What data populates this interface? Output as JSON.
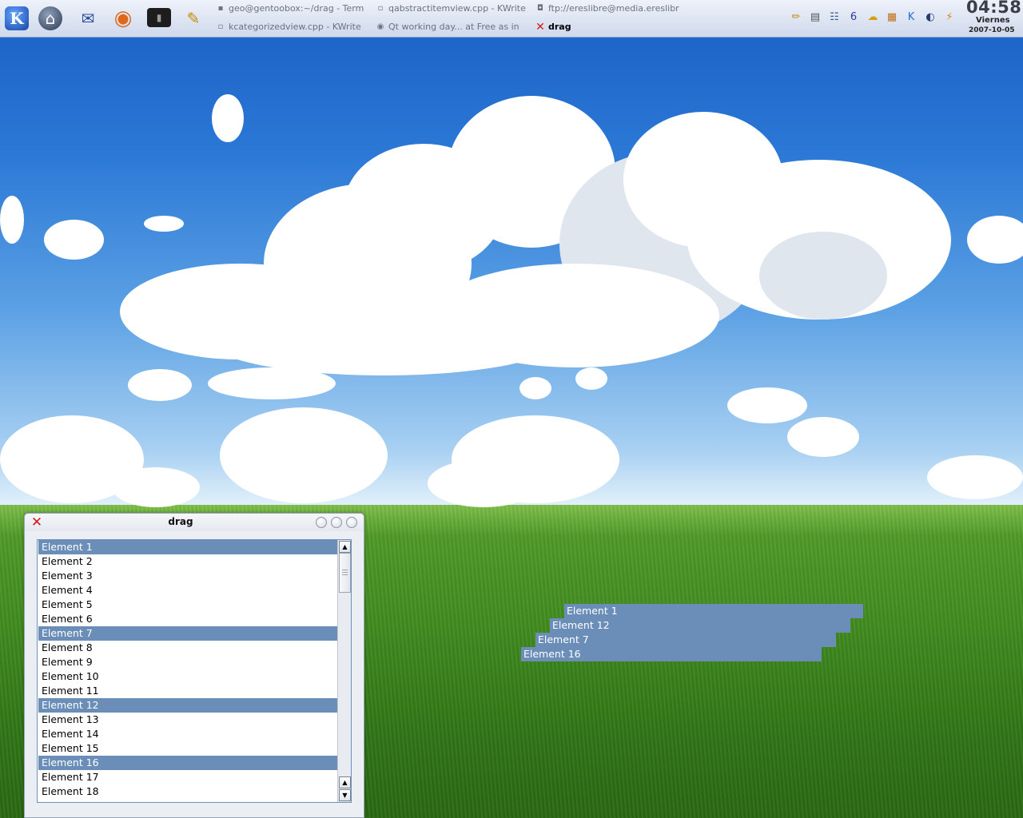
{
  "taskbar": {
    "launchers": [
      {
        "name": "kde-menu",
        "icon": "kde-logo-icon",
        "glyph": "K"
      },
      {
        "name": "home",
        "icon": "home-icon",
        "glyph": "⌂"
      },
      {
        "name": "calendar-mail",
        "icon": "calendar-mail-icon",
        "glyph": "✉"
      },
      {
        "name": "firefox",
        "icon": "firefox-icon",
        "glyph": "◉"
      },
      {
        "name": "terminal",
        "icon": "terminal-icon",
        "glyph": "▮"
      },
      {
        "name": "text-editor",
        "icon": "text-editor-icon",
        "glyph": "✎"
      }
    ],
    "tasks": [
      {
        "label": "geo@gentoobox:~/drag - Term",
        "icon": "terminal-icon",
        "glyph": "▪",
        "active": false
      },
      {
        "label": "qabstractitemview.cpp - KWrite",
        "icon": "kwrite-icon",
        "glyph": "▫",
        "active": false
      },
      {
        "label": "ftp://ereslibre@media.ereslibr",
        "icon": "ftp-icon",
        "glyph": "◘",
        "active": false
      },
      {
        "label": "kcategorizedview.cpp - KWrite",
        "icon": "kwrite-icon",
        "glyph": "▫",
        "active": false
      },
      {
        "label": "Qt working day... at Free as in",
        "icon": "firefox-icon",
        "glyph": "◉",
        "active": false
      },
      {
        "label": "drag",
        "icon": "x11-icon",
        "glyph": "✕",
        "active": true
      }
    ],
    "tray": [
      {
        "icon": "pencil-icon",
        "glyph": "✏"
      },
      {
        "icon": "clipboard-icon",
        "glyph": "▤"
      },
      {
        "icon": "contacts-icon",
        "glyph": "☷"
      },
      {
        "icon": "desktop-switch-icon",
        "glyph": "6"
      },
      {
        "icon": "network-icon",
        "glyph": "☁"
      },
      {
        "icon": "package-icon",
        "glyph": "▦"
      },
      {
        "icon": "kde-app-icon",
        "glyph": "K"
      },
      {
        "icon": "media-icon",
        "glyph": "◐"
      },
      {
        "icon": "weather-icon",
        "glyph": "⚡"
      }
    ],
    "clock": {
      "time": "04:58",
      "day": "Viernes",
      "date": "2007-10-05"
    }
  },
  "window": {
    "title": "drag",
    "items": [
      {
        "label": "Element 1",
        "selected": true
      },
      {
        "label": "Element 2",
        "selected": false
      },
      {
        "label": "Element 3",
        "selected": false
      },
      {
        "label": "Element 4",
        "selected": false
      },
      {
        "label": "Element 5",
        "selected": false
      },
      {
        "label": "Element 6",
        "selected": false
      },
      {
        "label": "Element 7",
        "selected": true
      },
      {
        "label": "Element 8",
        "selected": false
      },
      {
        "label": "Element 9",
        "selected": false
      },
      {
        "label": "Element 10",
        "selected": false
      },
      {
        "label": "Element 11",
        "selected": false
      },
      {
        "label": "Element 12",
        "selected": true
      },
      {
        "label": "Element 13",
        "selected": false
      },
      {
        "label": "Element 14",
        "selected": false
      },
      {
        "label": "Element 15",
        "selected": false
      },
      {
        "label": "Element 16",
        "selected": true
      },
      {
        "label": "Element 17",
        "selected": false
      },
      {
        "label": "Element 18",
        "selected": false
      }
    ]
  },
  "drag_ghost": [
    "Element 1",
    "Element 12",
    "Element 7",
    "Element 16"
  ],
  "colors": {
    "selection": "#6a8eb8",
    "sky": "#2b78d6",
    "grass": "#3f8a1e"
  }
}
